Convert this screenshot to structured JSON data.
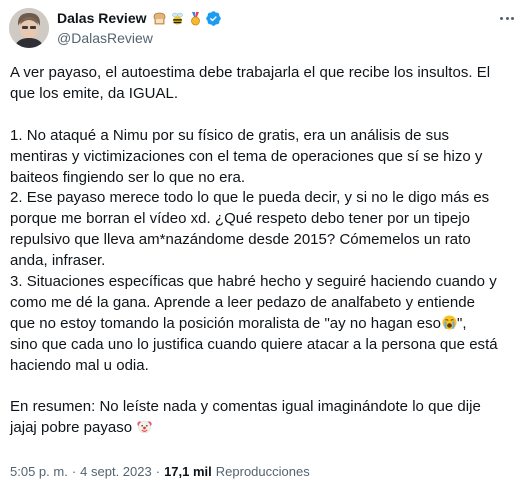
{
  "author": {
    "display_name": "Dalas Review",
    "handle": "@DalasReview",
    "badges": [
      "bread-icon",
      "bee-icon",
      "medal-icon",
      "verified-badge-icon"
    ],
    "verified_color": "#1d9bf0"
  },
  "tweet": {
    "lines": [
      "A ver payaso, el autoestima debe trabajarla el que recibe los insultos. El",
      "que los emite, da IGUAL.",
      "",
      "1. No ataqué a Nimu por su físico de gratis, era un análisis de sus",
      "mentiras y victimizaciones con el tema de operaciones que sí se hizo y",
      "baiteos fingiendo ser lo que no era.",
      "2. Ese payaso merece todo lo que le pueda decir, y si no le digo más es",
      "porque me borran el vídeo xd. ¿Qué respeto debo tener por un tipejo",
      "repulsivo que lleva am*nazándome desde 2015? Cómemelos un rato",
      "anda, infraser.",
      "3. Situaciones específicas que habré hecho y seguiré haciendo cuando y",
      "como me dé la gana. Aprende a leer pedazo de analfabeto y entiende",
      "que no estoy tomando la posición moralista de \"ay no hagan eso",
      "sino que cada uno lo justifica cuando quiere atacar a la persona que está",
      "haciendo mal u odia.",
      "",
      "En resumen: No leíste nada y comentas igual imaginándote lo que dije",
      "jajaj pobre payaso"
    ],
    "line13_suffix": "\",",
    "inline_icons": [
      "crying-face-emoji",
      "clown-face-emoji"
    ]
  },
  "meta": {
    "time": "5:05 p. m.",
    "separator": "·",
    "date": "4 sept. 2023",
    "views_count": "17,1 mil",
    "views_label": "Reproducciones"
  },
  "colors": {
    "text": "#0f1419",
    "secondary": "#536471",
    "background": "#ffffff"
  }
}
